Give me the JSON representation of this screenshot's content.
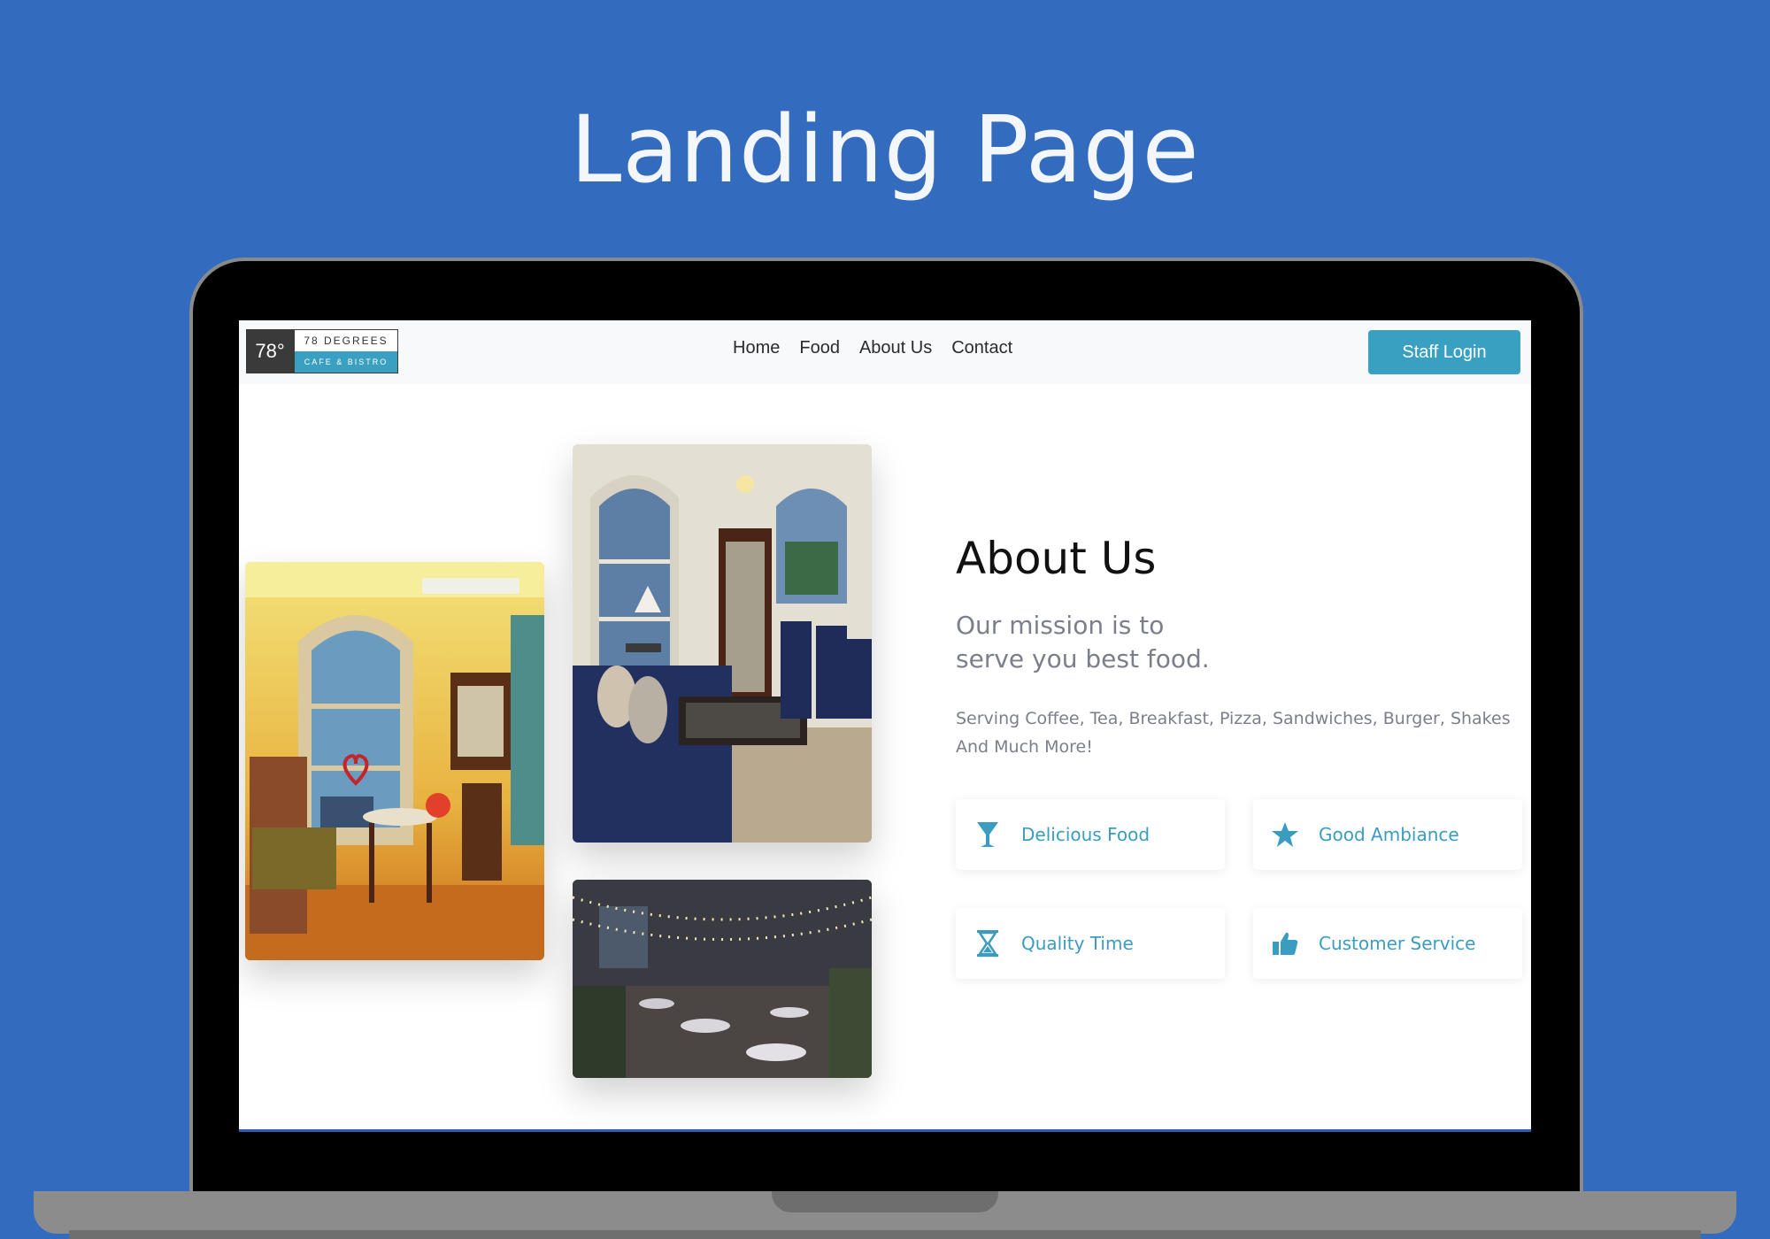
{
  "headline": "Landing Page",
  "navbar": {
    "logo": {
      "mark": "78°",
      "name": "78 DEGREES",
      "tagline": "CAFE & BISTRO"
    },
    "links": [
      "Home",
      "Food",
      "About Us",
      "Contact"
    ],
    "staff_login": "Staff Login"
  },
  "about": {
    "title": "About Us",
    "mission": "Our mission is to serve you best food.",
    "description": "Serving Coffee, Tea, Breakfast, Pizza, Sandwiches, Burger, Shakes And Much More!",
    "features": [
      {
        "label": "Delicious Food",
        "icon": "cocktail-glass-icon"
      },
      {
        "label": "Good Ambiance",
        "icon": "star-icon"
      },
      {
        "label": "Quality Time",
        "icon": "hourglass-icon"
      },
      {
        "label": "Customer Service",
        "icon": "thumbs-up-icon"
      }
    ]
  },
  "colors": {
    "page_background": "#336bbf",
    "accent": "#3aa0c2",
    "text_muted": "#7a7f8a"
  }
}
